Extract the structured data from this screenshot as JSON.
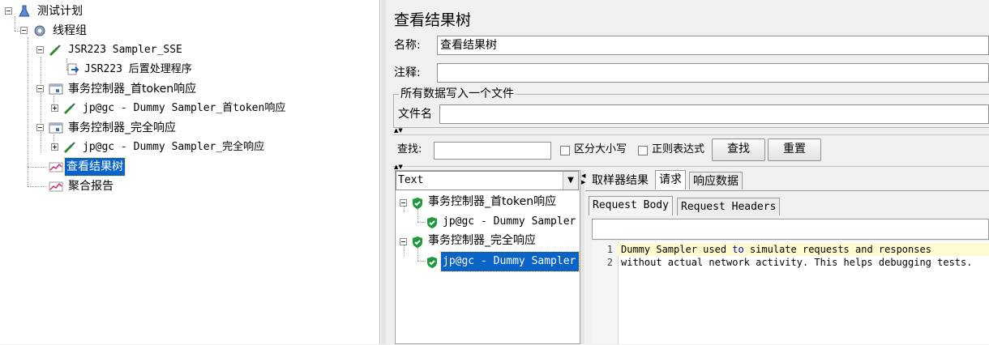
{
  "tree": {
    "test_plan": "测试计划",
    "thread_group": "线程组",
    "jsr223_sampler": "JSR223 Sampler_SSE",
    "jsr223_post": "JSR223 后置处理程序",
    "txn_first_token": "事务控制器_首token响应",
    "dummy_first_token": "jp@gc - Dummy Sampler_首token响应",
    "txn_complete": "事务控制器_完全响应",
    "dummy_complete": "jp@gc - Dummy Sampler_完全响应",
    "view_results_tree": "查看结果树",
    "aggregate_report": "聚合报告"
  },
  "panel": {
    "title": "查看结果树",
    "name_label": "名称:",
    "name_value": "查看结果树",
    "comment_label": "注释:",
    "comment_value": "",
    "file_group_title": "所有数据写入一个文件",
    "filename_label": "文件名",
    "filename_value": ""
  },
  "search": {
    "label": "查找:",
    "value": "",
    "case_label": "区分大小写",
    "regex_label": "正则表达式",
    "find_button": "查找",
    "reset_button": "重置"
  },
  "results": {
    "renderer": "Text",
    "tree": [
      {
        "label": "事务控制器_首token响应",
        "status": "success"
      },
      {
        "label": "jp@gc - Dummy Sampler",
        "status": "success"
      },
      {
        "label": "事务控制器_完全响应",
        "status": "success"
      },
      {
        "label": "jp@gc - Dummy Sampler",
        "status": "success",
        "selected": true
      }
    ],
    "tabs": [
      "取样器结果",
      "请求",
      "响应数据"
    ],
    "active_tab": "请求",
    "subtabs": [
      "Request Body",
      "Request Headers"
    ],
    "active_subtab": "Request Body",
    "line_numbers": [
      "1",
      "2"
    ],
    "body_lines": {
      "line1_a": "Dummy Sampler used ",
      "line1_kw": "to",
      "line1_b": " simulate requests and responses",
      "line2": "without actual network activity. This helps debugging tests."
    }
  },
  "colors": {
    "selection": "#0a64c8",
    "success_check": "#1e9a3c",
    "current_line": "#fffbd0",
    "keyword": "#0000c8"
  }
}
